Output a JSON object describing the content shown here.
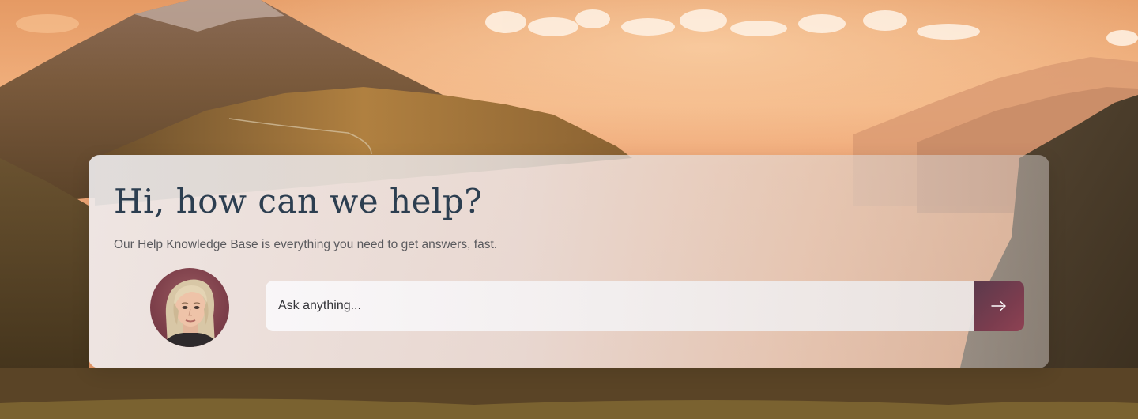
{
  "help_card": {
    "title": "Hi, how can we help?",
    "subtitle": "Our Help Knowledge Base is everything you need to get answers, fast."
  },
  "search": {
    "placeholder": "Ask anything...",
    "value": ""
  },
  "icons": {
    "submit": "arrow-right-icon",
    "avatar": "support-agent-avatar"
  },
  "colors": {
    "title": "#2c3e50",
    "subtitle": "#5a5a5e",
    "button_start": "#5b3a4c",
    "button_end": "#8e4253"
  }
}
